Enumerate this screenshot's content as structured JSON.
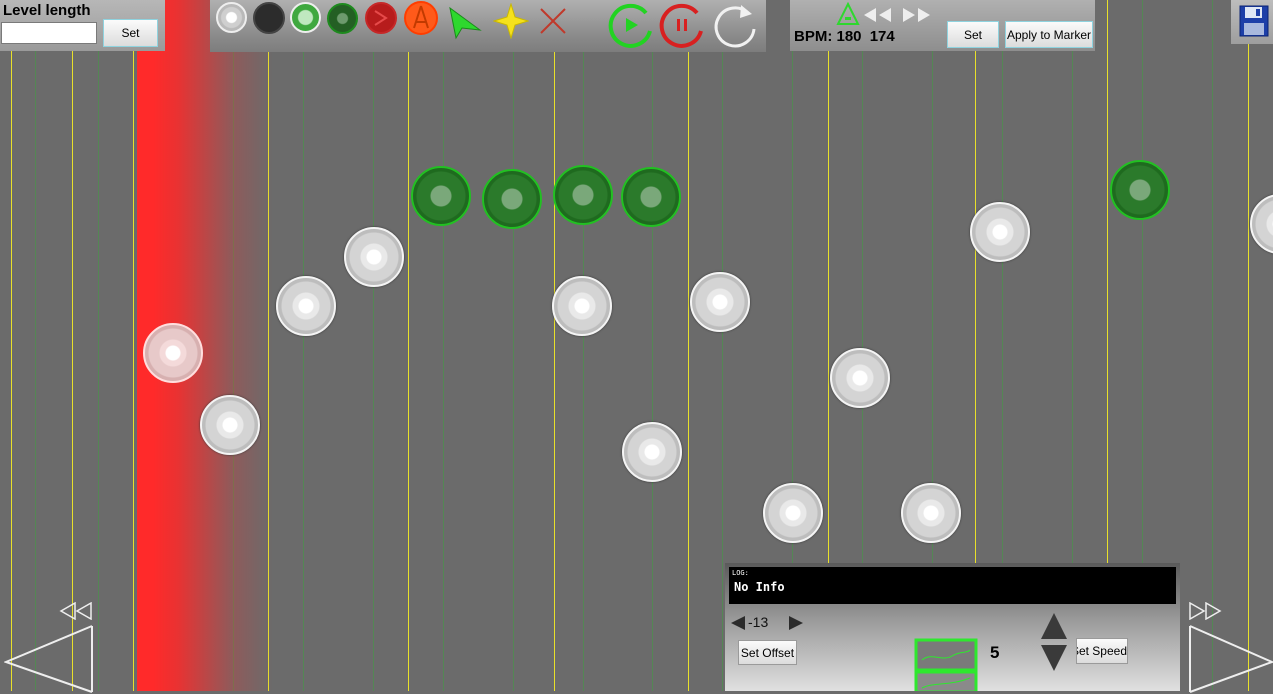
{
  "level_panel": {
    "title": "Level length",
    "input_value": "",
    "set_label": "Set"
  },
  "toolbar": {
    "tools": [
      {
        "name": "white-note-tool-icon"
      },
      {
        "name": "black-note-tool-icon"
      },
      {
        "name": "green-light-note-tool-icon"
      },
      {
        "name": "green-dark-note-tool-icon"
      },
      {
        "name": "red-note-tool-icon"
      },
      {
        "name": "orange-note-tool-icon"
      },
      {
        "name": "select-arrow-tool-icon"
      },
      {
        "name": "star-tool-icon"
      },
      {
        "name": "delete-tool-icon"
      },
      {
        "name": "play-icon"
      },
      {
        "name": "pause-icon"
      },
      {
        "name": "reload-icon"
      }
    ]
  },
  "bpm_panel": {
    "label": "BPM:",
    "value": "180",
    "value2": "174",
    "set_label": "Set",
    "apply_label": "Apply to Marker"
  },
  "log_panel": {
    "label": "LOG:",
    "text": "No Info"
  },
  "offset": {
    "value": "-13",
    "set_label": "Set Offset"
  },
  "speed": {
    "value": "5",
    "set_label": "Set Speed"
  },
  "colors": {
    "background": "#6b6b6b",
    "grid_yellow": "#e8e02a",
    "playhead": "#ff2a2a",
    "note_green": "#22c022"
  }
}
